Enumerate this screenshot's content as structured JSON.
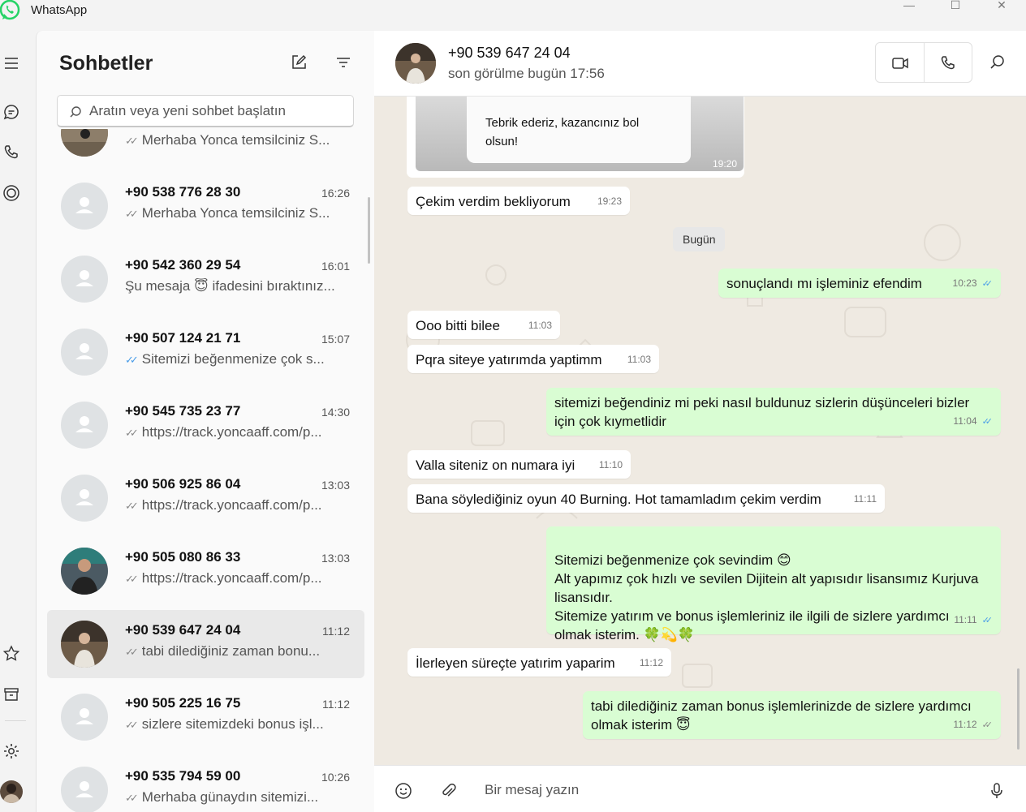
{
  "app": {
    "title": "WhatsApp",
    "colors": {
      "outgoing_bubble": "#d9fdd3",
      "incoming_bubble": "#ffffff",
      "chat_background": "#efeae2",
      "read_tick": "#4a9de8",
      "brand": "#25d366"
    }
  },
  "window_controls": {
    "minimize": "—",
    "maximize": "☐",
    "close": "✕"
  },
  "rail": {
    "top_icons": [
      "menu-icon",
      "chats-icon",
      "calls-icon",
      "status-icon"
    ],
    "bottom_icons": [
      "starred-icon",
      "archive-icon",
      "settings-icon",
      "profile-avatar"
    ]
  },
  "chat_list": {
    "title": "Sohbetler",
    "new_chat_icon": "compose-icon",
    "filter_icon": "filter-icon",
    "search_placeholder": "Aratın veya yeni sohbet başlatın",
    "items": [
      {
        "name": "",
        "time": "",
        "preview": "Merhaba Yonca temsilciniz S...",
        "tick": "grey"
      },
      {
        "name": "+90 538 776 28 30",
        "time": "16:26",
        "preview": "Merhaba Yonca temsilciniz S...",
        "tick": "grey"
      },
      {
        "name": "+90 542 360 29 54",
        "time": "16:01",
        "preview": "Şu mesaja 😇 ifadesini bıraktınız...",
        "tick": "none"
      },
      {
        "name": "+90 507 124 21 71",
        "time": "15:07",
        "preview": "Sitemizi beğenmenize çok s...",
        "tick": "blue"
      },
      {
        "name": "+90 545 735 23 77",
        "time": "14:30",
        "preview": "https://track.yoncaaff.com/p...",
        "tick": "grey"
      },
      {
        "name": "+90 506 925 86 04",
        "time": "13:03",
        "preview": "https://track.yoncaaff.com/p...",
        "tick": "grey"
      },
      {
        "name": "+90 505 080 86 33",
        "time": "13:03",
        "preview": "https://track.yoncaaff.com/p...",
        "tick": "grey"
      },
      {
        "name": "+90 539 647 24 04",
        "time": "11:12",
        "preview": "tabi dilediğiniz zaman bonu...",
        "tick": "grey"
      },
      {
        "name": "+90 505 225 16 75",
        "time": "11:12",
        "preview": "sizlere sitemizdeki bonus işl...",
        "tick": "grey"
      },
      {
        "name": "+90 535 794 59 00",
        "time": "10:26",
        "preview": "Merhaba günaydın sitemizi...",
        "tick": "grey"
      }
    ]
  },
  "chat": {
    "contact_name": "+90 539 647 24 04",
    "contact_status": "son görülme bugün 17:56",
    "header_icons": [
      "video-call-icon",
      "voice-call-icon",
      "search-icon"
    ],
    "image_message": {
      "text": "Tebrik ederiz, kazancınız bol olsun!",
      "time": "19:20"
    },
    "day_divider": "Bugün",
    "messages": [
      {
        "dir": "in",
        "text": "Çekim verdim bekliyorum",
        "time": "19:23"
      },
      {
        "dir": "out",
        "text": "sonuçlandı mı işleminiz efendim",
        "time": "10:23",
        "tick": "blue"
      },
      {
        "dir": "in",
        "text": "Ooo bitti bilee",
        "time": "11:03"
      },
      {
        "dir": "in",
        "text": "Pqra siteye yatırımda yaptimm",
        "time": "11:03"
      },
      {
        "dir": "out",
        "text": "sitemizi beğendiniz mi peki nasıl buldunuz sizlerin düşünceleri bizler için çok kıymetlidir",
        "time": "11:04",
        "tick": "blue"
      },
      {
        "dir": "in",
        "text": "Valla siteniz on numara iyi",
        "time": "11:10"
      },
      {
        "dir": "in",
        "text": "Bana söylediğiniz oyun 40 Burning. Hot tamamladım çekim verdim",
        "time": "11:11"
      },
      {
        "dir": "out",
        "text": "Sitemizi beğenmenize çok sevindim 😊\nAlt yapımız çok hızlı ve sevilen Dijitein alt yapısıdır lisansımız Kurjuva lisansıdır.\nSitemize yatırım ve bonus işlemleriniz  ile ilgili de sizlere  yardımcı olmak isterim.  🍀💫🍀",
        "time": "11:11",
        "tick": "blue"
      },
      {
        "dir": "in",
        "text": "İlerleyen süreçte yatırim yaparim",
        "time": "11:12"
      },
      {
        "dir": "out",
        "text": "tabi dilediğiniz zaman bonus işlemlerinizde de sizlere yardımcı olmak isterim 😇",
        "time": "11:12",
        "tick": "grey"
      }
    ]
  },
  "composer": {
    "placeholder": "Bir mesaj yazın",
    "icons": [
      "emoji-icon",
      "attach-icon",
      "microphone-icon"
    ]
  }
}
